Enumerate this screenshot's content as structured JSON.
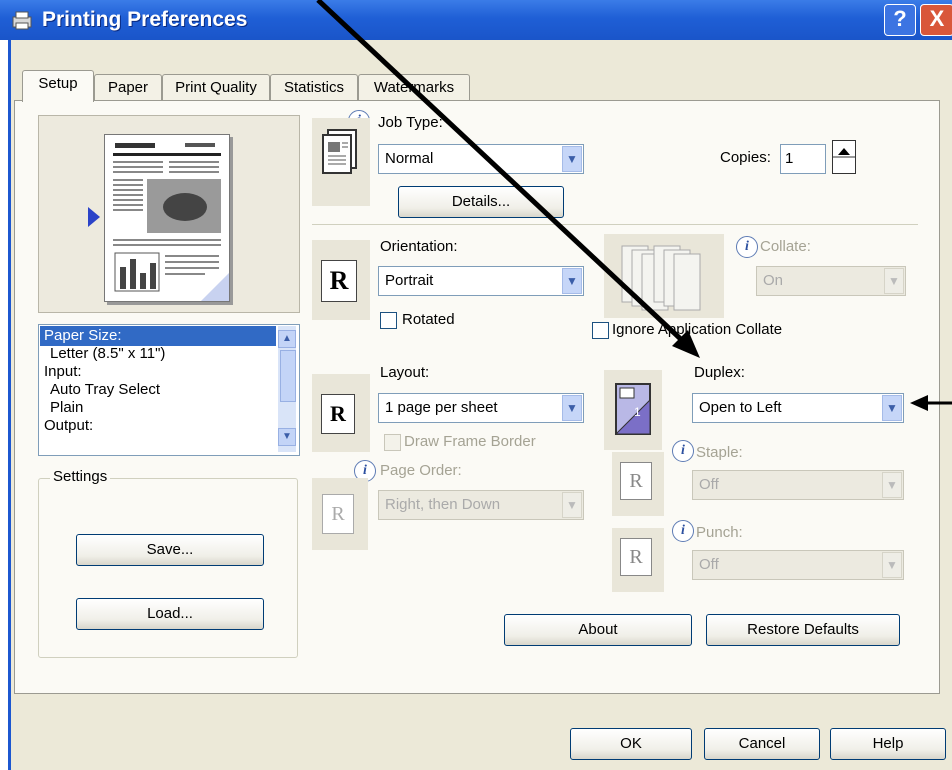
{
  "window": {
    "title": "Printing Preferences",
    "help_btn": "?",
    "close_btn": "X"
  },
  "tabs": [
    {
      "label": "Setup"
    },
    {
      "label": "Paper"
    },
    {
      "label": "Print Quality"
    },
    {
      "label": "Statistics"
    },
    {
      "label": "Watermarks"
    }
  ],
  "summary_list": [
    "Paper Size:",
    "Letter (8.5\" x 11\")",
    "Input:",
    "Auto Tray Select",
    "Plain",
    "Output:"
  ],
  "settings": {
    "group_label": "Settings",
    "save": "Save...",
    "load": "Load..."
  },
  "job": {
    "label": "Job Type:",
    "value": "Normal",
    "details": "Details..."
  },
  "copies": {
    "label": "Copies:",
    "value": "1"
  },
  "orientation": {
    "label": "Orientation:",
    "value": "Portrait",
    "rotated": "Rotated",
    "glyph": "R"
  },
  "collate": {
    "label": "Collate:",
    "value": "On",
    "ignore": "Ignore Application Collate"
  },
  "layout": {
    "label": "Layout:",
    "value": "1 page per sheet",
    "frame": "Draw Frame Border",
    "glyph": "R"
  },
  "page_order": {
    "label": "Page Order:",
    "value": "Right, then Down",
    "glyph": "R"
  },
  "duplex": {
    "label": "Duplex:",
    "value": "Open to Left"
  },
  "staple": {
    "label": "Staple:",
    "value": "Off",
    "glyph": "R"
  },
  "punch": {
    "label": "Punch:",
    "value": "Off",
    "glyph": "R"
  },
  "buttons": {
    "about": "About",
    "restore": "Restore Defaults",
    "ok": "OK",
    "cancel": "Cancel",
    "help": "Help"
  },
  "info_glyph": "i"
}
